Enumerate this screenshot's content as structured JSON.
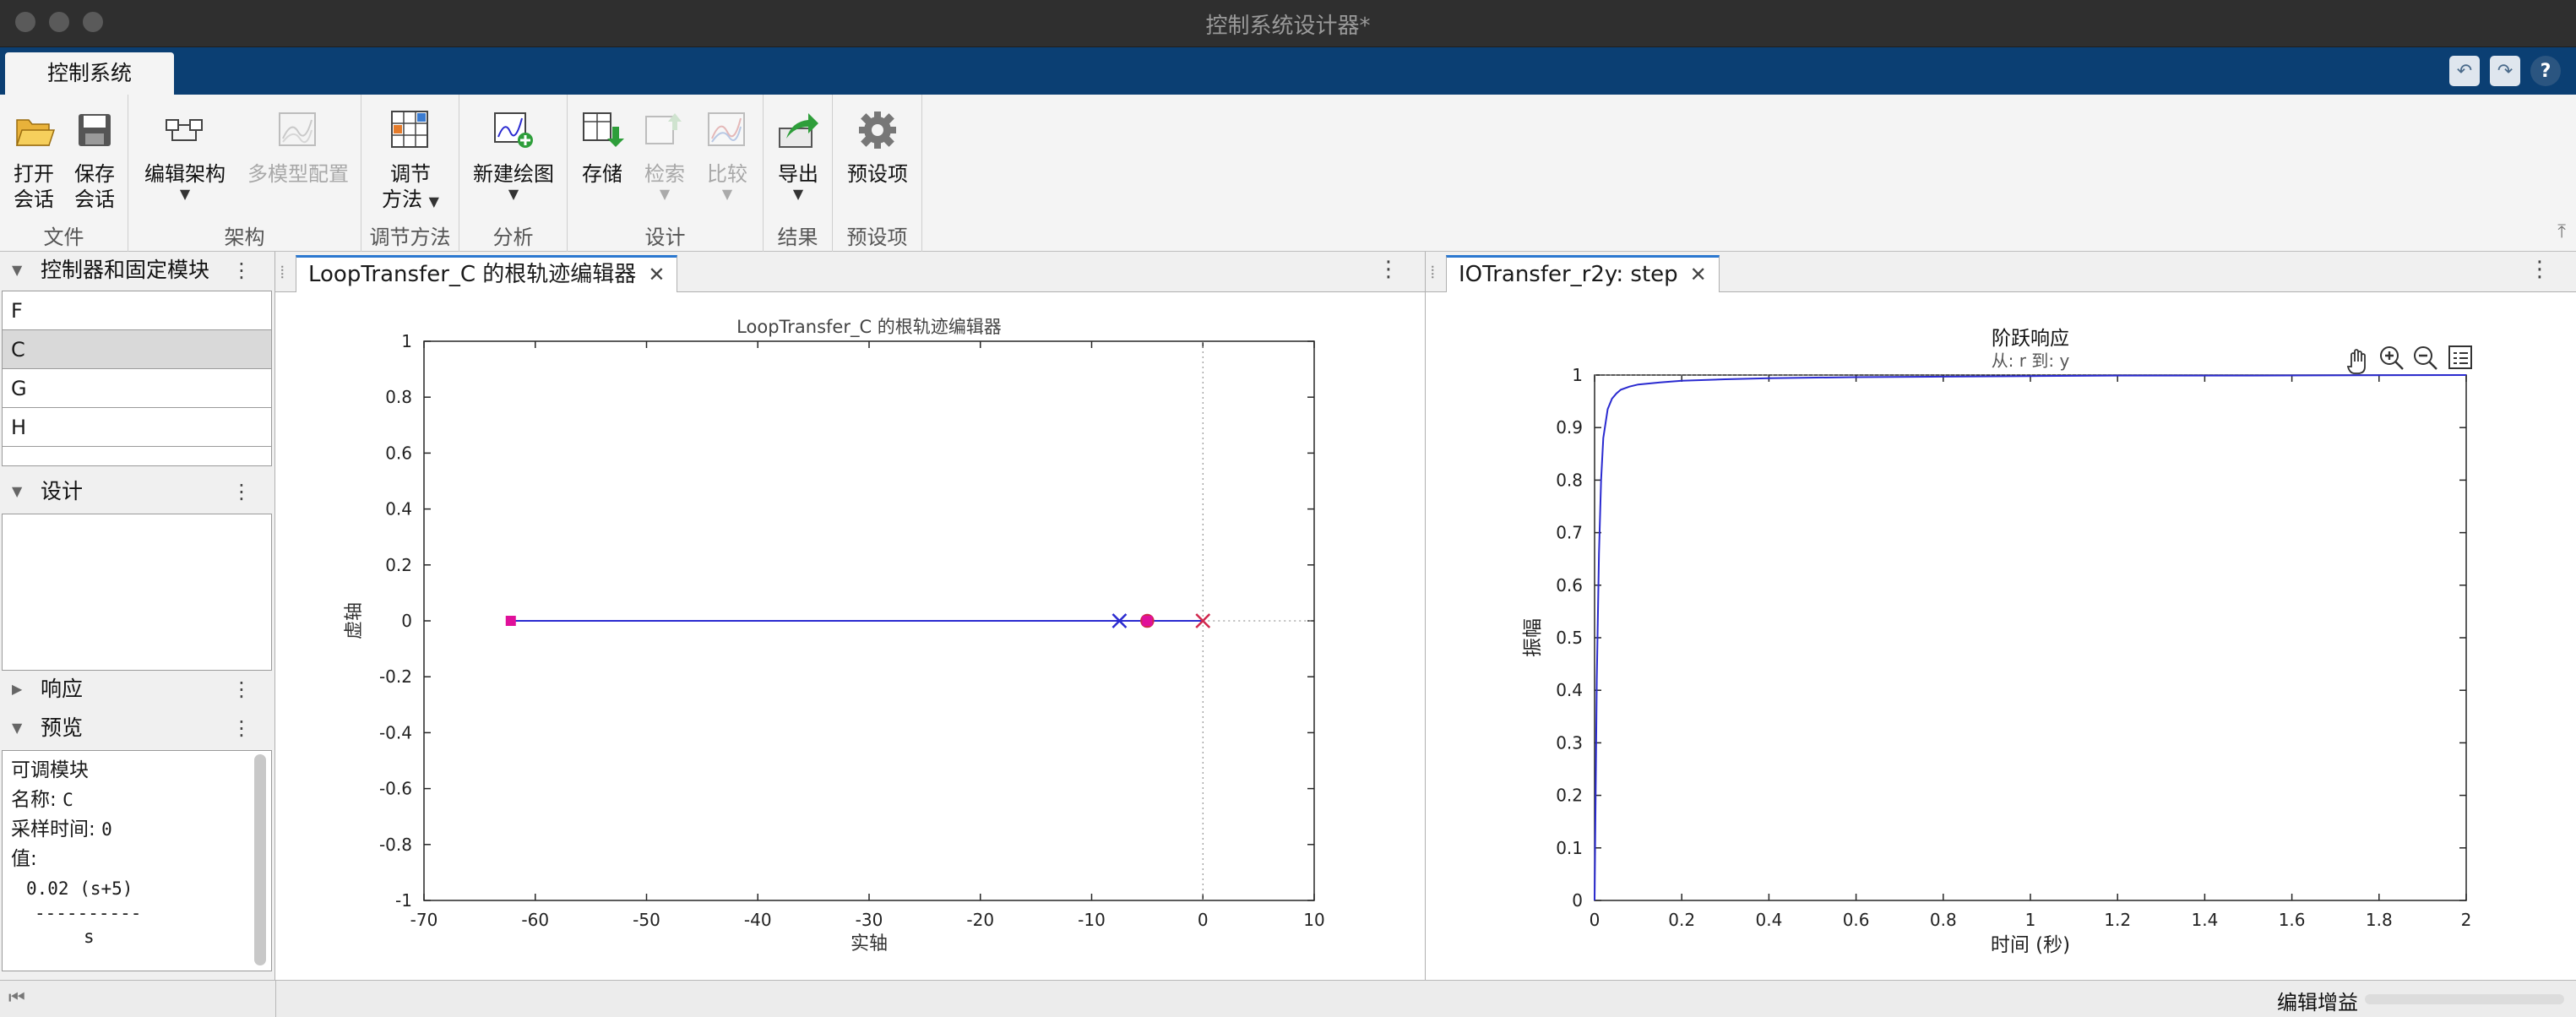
{
  "window": {
    "title": "控制系统设计器*"
  },
  "main_tab": {
    "label": "控制系统"
  },
  "ribbon": {
    "groups": {
      "file": "文件",
      "arch": "架构",
      "tuning": "调节方法",
      "analysis": "分析",
      "design": "设计",
      "results": "结果",
      "prefs": "预设项"
    },
    "buttons": {
      "open_l1": "打开",
      "open_l2": "会话",
      "save_l1": "保存",
      "save_l2": "会话",
      "edit_arch": "编辑架构",
      "multi_model": "多模型配置",
      "tuning_l1": "调节",
      "tuning_l2": "方法",
      "new_plot": "新建绘图",
      "store": "存储",
      "retrieve": "检索",
      "compare": "比较",
      "export": "导出",
      "preferences": "预设项"
    }
  },
  "left_panel": {
    "blocks_header": "控制器和固定模块",
    "blocks": [
      "F",
      "C",
      "G",
      "H"
    ],
    "selected_block": "C",
    "design_header": "设计",
    "response_header": "响应",
    "preview_header": "预览",
    "preview": {
      "heading": "可调模块",
      "name_label": "名称:",
      "name_value": "C",
      "sample_label": "采样时间:",
      "sample_value": "0",
      "value_label": "值:",
      "numerator": "0.02 (s+5)",
      "fraction_bar": "----------",
      "denominator": "s"
    }
  },
  "root_locus": {
    "tab_label": "LoopTransfer_C 的根轨迹编辑器",
    "chart_data": {
      "type": "scatter",
      "title": "LoopTransfer_C 的根轨迹编辑器",
      "xlabel": "实轴",
      "ylabel": "虚轴",
      "xlim": [
        -70,
        10
      ],
      "ylim": [
        -1,
        1
      ],
      "xticks": [
        -70,
        -60,
        -50,
        -40,
        -30,
        -20,
        -10,
        0,
        10
      ],
      "yticks": [
        -1,
        -0.8,
        -0.6,
        -0.4,
        -0.2,
        0,
        0.2,
        0.4,
        0.6,
        0.8,
        1
      ],
      "locus_range": [
        -62,
        0
      ],
      "open_loop_poles": [
        0,
        -7.5
      ],
      "zeros": [
        -5
      ],
      "closed_loop_poles": [
        -62.2,
        -5
      ],
      "colors": {
        "locus": "#2a2ad0",
        "pole_open": "#d0284e",
        "pole_blue": "#2a2ad0",
        "closed": "#e0109a",
        "axes": "#262626",
        "grid": "#808080"
      }
    }
  },
  "step_response": {
    "tab_label": "IOTransfer_r2y: step",
    "chart_data": {
      "type": "line",
      "title": "阶跃响应",
      "subtitle": "从: r  到: y",
      "xlabel": "时间 (秒)",
      "ylabel": "振幅",
      "xlim": [
        0,
        2
      ],
      "ylim": [
        0,
        1
      ],
      "xticks": [
        0,
        0.2,
        0.4,
        0.6,
        0.8,
        1,
        1.2,
        1.4,
        1.6,
        1.8,
        2
      ],
      "yticks": [
        0,
        0.1,
        0.2,
        0.3,
        0.4,
        0.5,
        0.6,
        0.7,
        0.8,
        0.9,
        1
      ],
      "x": [
        0,
        0.005,
        0.01,
        0.015,
        0.02,
        0.03,
        0.04,
        0.05,
        0.06,
        0.08,
        0.1,
        0.15,
        0.2,
        0.3,
        0.4,
        0.6,
        0.8,
        1,
        1.2,
        1.5,
        2
      ],
      "y": [
        0,
        0.42,
        0.66,
        0.8,
        0.88,
        0.935,
        0.955,
        0.965,
        0.972,
        0.978,
        0.982,
        0.986,
        0.989,
        0.992,
        0.994,
        0.996,
        0.997,
        0.998,
        0.999,
        0.999,
        1
      ],
      "colors": {
        "line": "#2a2ad0",
        "axes": "#262626",
        "grid": "#808080"
      }
    }
  },
  "toolbar_icons": [
    "pan-hand-icon",
    "zoom-in-icon",
    "zoom-out-icon",
    "legend-icon"
  ],
  "status": {
    "message": "编辑增益"
  }
}
